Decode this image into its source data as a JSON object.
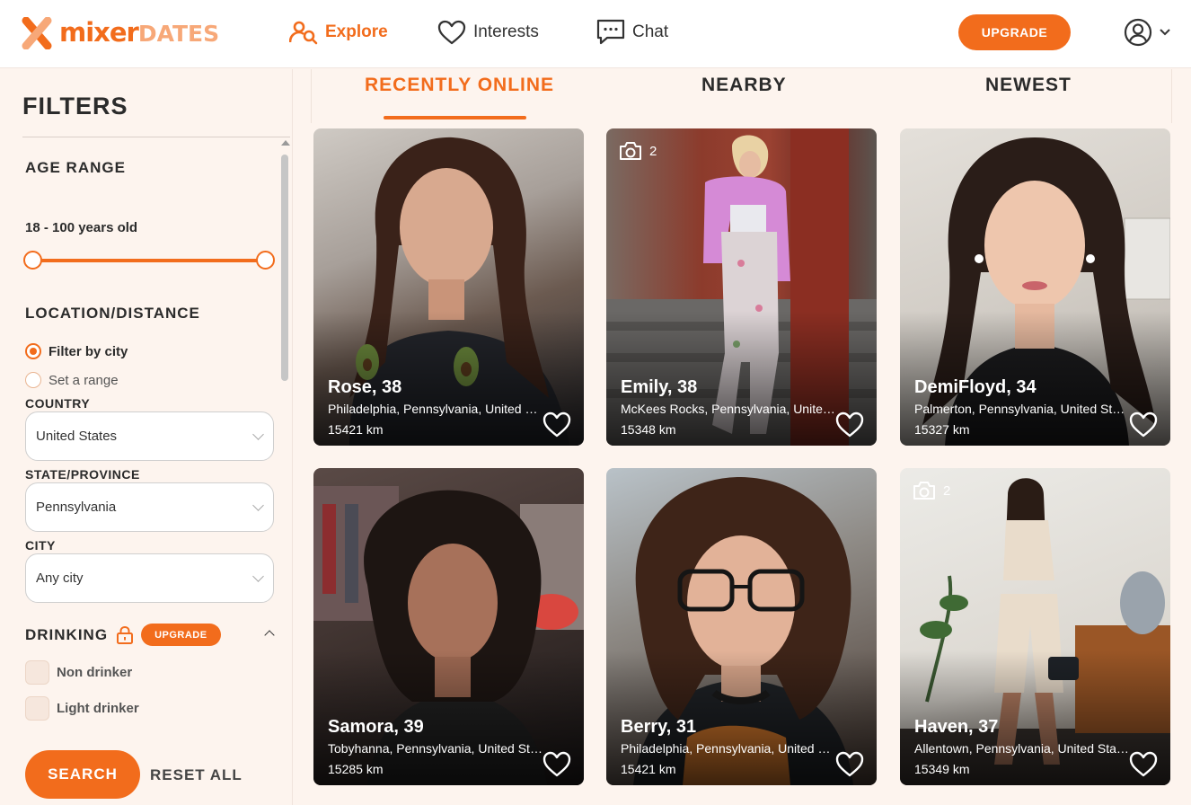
{
  "brand": {
    "word1": "mixer",
    "word2": "DATES"
  },
  "nav": {
    "explore": "Explore",
    "interests": "Interests",
    "chat": "Chat",
    "upgrade": "UPGRADE"
  },
  "filters": {
    "title": "FILTERS",
    "age_range": {
      "label": "AGE RANGE",
      "value": "18 - 100 years old",
      "min": 18,
      "max": 100
    },
    "location": {
      "label": "LOCATION/DISTANCE",
      "options": [
        "Filter by city",
        "Set a range"
      ],
      "selected": "Filter by city",
      "country_label": "COUNTRY",
      "country_value": "United States",
      "state_label": "STATE/PROVINCE",
      "state_value": "Pennsylvania",
      "city_label": "CITY",
      "city_value": "Any city"
    },
    "drinking": {
      "label": "DRINKING",
      "upgrade": "UPGRADE",
      "options": [
        "Non drinker",
        "Light drinker"
      ]
    },
    "search": "SEARCH",
    "reset": "RESET ALL"
  },
  "tabs": [
    "RECENTLY ONLINE",
    "NEARBY",
    "NEWEST"
  ],
  "active_tab": "RECENTLY ONLINE",
  "profiles": [
    {
      "name": "Rose, 38",
      "location": "Philadelphia, Pennsylvania, United States",
      "distance": "15421 km",
      "photos": ""
    },
    {
      "name": "Emily, 38",
      "location": "McKees Rocks, Pennsylvania, United States",
      "distance": "15348 km",
      "photos": "2"
    },
    {
      "name": "DemiFloyd, 34",
      "location": "Palmerton, Pennsylvania, United States",
      "distance": "15327 km",
      "photos": ""
    },
    {
      "name": "Samora, 39",
      "location": "Tobyhanna, Pennsylvania, United States",
      "distance": "15285 km",
      "photos": ""
    },
    {
      "name": "Berry, 31",
      "location": "Philadelphia, Pennsylvania, United States",
      "distance": "15421 km",
      "photos": ""
    },
    {
      "name": "Haven, 37",
      "location": "Allentown, Pennsylvania, United States",
      "distance": "15349 km",
      "photos": "2"
    }
  ],
  "colors": {
    "accent": "#f26c1c",
    "background": "#fdf4ee"
  }
}
